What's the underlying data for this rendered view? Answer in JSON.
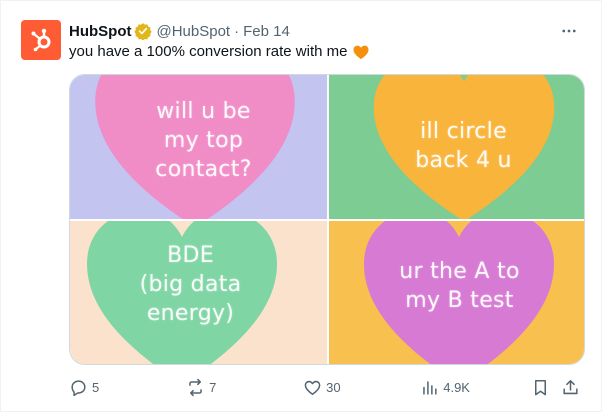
{
  "author": {
    "name": "HubSpot",
    "handle": "@HubSpot",
    "separator": "·",
    "date": "Feb 14"
  },
  "tweet": {
    "text": "you have a 100% conversion rate with me"
  },
  "media": {
    "panels": [
      {
        "text": "will u be\nmy top\ncontact?",
        "bg": "#c4c4f1",
        "heart": "#f08cc6"
      },
      {
        "text": "ill circle\nback 4 u",
        "bg": "#7ccc94",
        "heart": "#f9b43c"
      },
      {
        "text": "BDE\n(big data\nenergy)",
        "bg": "#fbe2cd",
        "heart": "#7fd5a4"
      },
      {
        "text": "ur the A to\nmy B test",
        "bg": "#f8c04e",
        "heart": "#d67ad3"
      }
    ]
  },
  "actions": {
    "replies": "5",
    "reposts": "7",
    "likes": "30",
    "views": "4.9K"
  },
  "colors": {
    "brand": "#ff5c35",
    "verified": "#e2b719",
    "muted": "#536471"
  },
  "icons": {
    "avatar": "hubspot-sprocket-icon",
    "verified": "verified-badge-icon",
    "emoji": "orange-heart-icon",
    "more": "more-dots-icon",
    "reply": "reply-icon",
    "repost": "repost-icon",
    "like": "like-icon",
    "views": "views-icon",
    "bookmark": "bookmark-icon",
    "share": "share-icon"
  }
}
